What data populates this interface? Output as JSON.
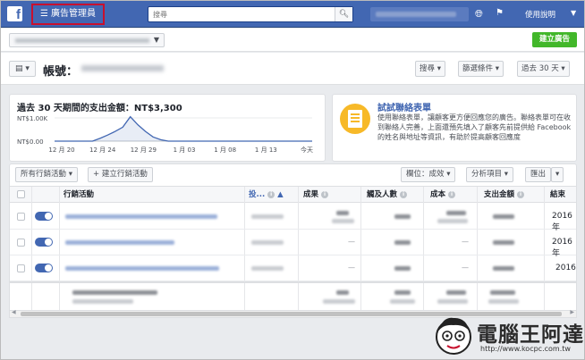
{
  "topbar": {
    "logo": "f",
    "menu_label": "廣告管理員",
    "search_placeholder": "搜尋",
    "account_name_blurred": "Cian Tzu-Weilong",
    "help_label": "使用說明",
    "colors": {
      "bar": "#4267b2",
      "highlight_box": "#c8102e"
    }
  },
  "account_bar": {
    "account_select_blurred": "Cian Tzu-Weilong (XXXXXXXXXXXXXXX)",
    "create_ad_label": "建立廣告",
    "create_ad_color": "#42b72a"
  },
  "title_row": {
    "account_label": "帳號：",
    "account_id_blurred": "XXXXXXXXXXXXXXX",
    "search_btn": "搜尋",
    "filter_btn": "篩選條件",
    "date_btn": "過去 30 天"
  },
  "spend_card": {
    "title": "過去 30 天期間的支出金額：NT$3,300",
    "chart_data": {
      "type": "area",
      "title": "過去 30 天期間的支出金額：NT$3,300",
      "y_tick_labels": [
        "NT$1.00K",
        "NT$0.00"
      ],
      "x_tick_labels": [
        "12 月 20",
        "12 月 24",
        "12  月 29",
        "1 月 03",
        "1 月 08",
        "1 月 13",
        "今天"
      ],
      "ylim": [
        0,
        1000
      ],
      "series": [
        {
          "values": [
            0,
            0,
            0,
            0,
            0,
            0,
            120,
            260,
            420,
            600,
            1100,
            700,
            420,
            180,
            60,
            0,
            0,
            0,
            0,
            0,
            0,
            0,
            0,
            0,
            0,
            0,
            0,
            0,
            0,
            0,
            0,
            0,
            0,
            0,
            0
          ]
        }
      ],
      "color": "#4267b2"
    }
  },
  "form_card": {
    "title": "試試聯絡表單",
    "description": "使用聯絡表單，讓顧客更方便回應您的廣告。聯絡表單可在收到聯絡人完善，上面還預先填入了顧客先前提供給 Facebook 的姓名與地址等資訊，有助於提高顧客回應度"
  },
  "campaign_toolbar": {
    "all_campaigns": "所有行銷活動",
    "create_campaign": "建立行銷活動",
    "columns": "欄位：成效",
    "breakdown": "分析項目",
    "export": "匯出"
  },
  "table": {
    "headers": [
      "行銷活動",
      "投...",
      "成果",
      "觸及人數",
      "成本",
      "支出金額",
      "結束"
    ],
    "rows": [
      {
        "end": "2016年"
      },
      {
        "end": "2016年"
      },
      {
        "end": "2016"
      },
      {
        "end": ""
      }
    ]
  },
  "watermark": {
    "brand": "電腦王阿達",
    "url": "http://www.kocpc.com.tw"
  }
}
